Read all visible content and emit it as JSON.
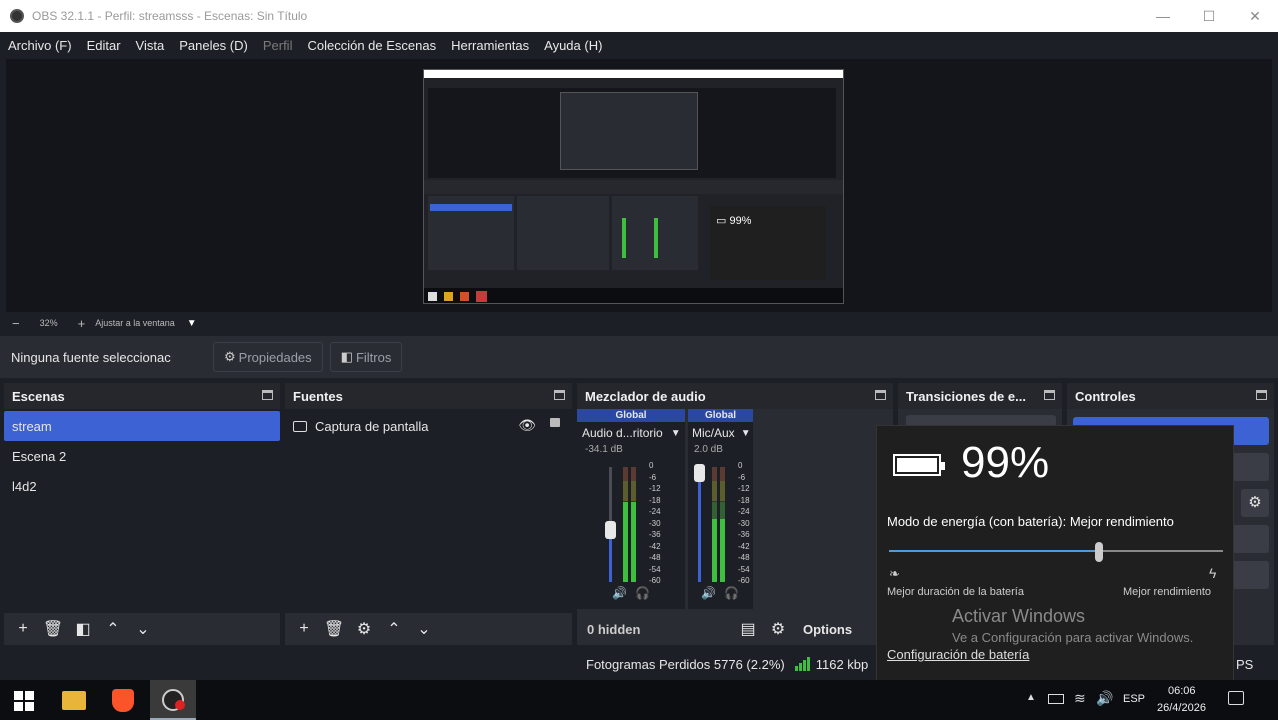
{
  "titlebar": {
    "title": "OBS 32.1.1 - Perfil: streamsss - Escenas: Sin Título",
    "min": "—",
    "max": "☐",
    "close": "✕"
  },
  "menu": [
    {
      "label": "Archivo (F)"
    },
    {
      "label": "Editar"
    },
    {
      "label": "Vista"
    },
    {
      "label": "Paneles (D)"
    },
    {
      "label": "Perfil",
      "dim": true
    },
    {
      "label": "Colección de Escenas"
    },
    {
      "label": "Herramientas"
    },
    {
      "label": "Ayuda (H)"
    }
  ],
  "zoom": {
    "minus": "−",
    "percent": "32%",
    "plus": "+",
    "fit": "Ajustar a la ventana"
  },
  "source_bar": {
    "none_selected": "Ninguna fuente seleccionac",
    "properties": "Propiedades",
    "filters": "Filtros"
  },
  "scenes": {
    "title": "Escenas",
    "items": [
      "stream",
      "Escena 2",
      "l4d2"
    ],
    "selected": 0
  },
  "sources": {
    "title": "Fuentes",
    "items": [
      "Captura de pantalla"
    ]
  },
  "mixer": {
    "title": "Mezclador de audio",
    "channels": [
      {
        "badge": "Global",
        "name": "Audio d...ritorio",
        "db": "-34.1 dB",
        "fader": 0.45,
        "level": 0.7
      },
      {
        "badge": "Global",
        "name": "Mic/Aux",
        "db": "2.0 dB",
        "fader": 0.95,
        "level": 0.55
      }
    ],
    "scale": [
      "0",
      "-6",
      "-12",
      "-18",
      "-24",
      "-30",
      "-36",
      "-42",
      "-48",
      "-54",
      "-60"
    ],
    "hidden": "0 hidden",
    "options": "Options"
  },
  "transitions": {
    "title": "Transiciones de e..."
  },
  "controls": {
    "title": "Controles"
  },
  "status": {
    "dropped": "Fotogramas Perdidos 5776 (2.2%)",
    "bitrate": "1162 kbp",
    "fps_tail": "PS"
  },
  "battery": {
    "percent": "99%",
    "mode": "Modo de energía (con batería): Mejor rendimiento",
    "slider_value": 0.63,
    "left_label": "Mejor duración de la batería",
    "right_label": "Mejor rendimiento",
    "link": "Configuración de batería"
  },
  "watermark": {
    "line1": "Activar Windows",
    "line2": "Ve a Configuración para activar Windows."
  },
  "taskbar": {
    "lang": "ESP",
    "time": "06:06",
    "date": "26/4/2026"
  },
  "colors": {
    "accent": "#3d62d3",
    "panel": "#2a2c33",
    "bg": "#1d1f26",
    "meter_green": "#3fbf3f",
    "meter_yellow": "#c8b22a",
    "meter_red": "#c83a3a"
  }
}
